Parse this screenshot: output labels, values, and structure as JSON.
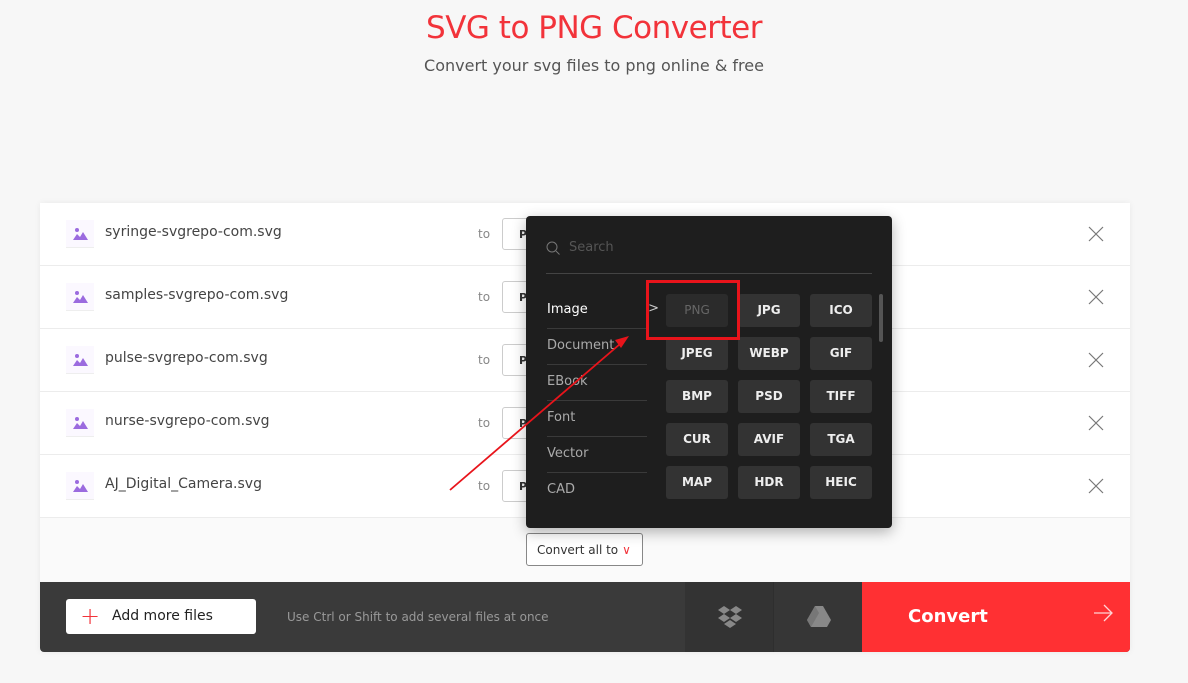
{
  "header": {
    "title": "SVG to PNG Converter",
    "subtitle": "Convert your svg files to png online & free"
  },
  "files": [
    {
      "name": "syringe-svgrepo-com.svg",
      "to": "to",
      "format": "PNG"
    },
    {
      "name": "samples-svgrepo-com.svg",
      "to": "to",
      "format": "PNG"
    },
    {
      "name": "pulse-svgrepo-com.svg",
      "to": "to",
      "format": "PNG"
    },
    {
      "name": "nurse-svgrepo-com.svg",
      "to": "to",
      "format": "PNG"
    },
    {
      "name": "AJ_Digital_Camera.svg",
      "to": "to",
      "format": "PNG"
    }
  ],
  "dropdown": {
    "search_placeholder": "Search",
    "categories": [
      "Image",
      "Document",
      "EBook",
      "Font",
      "Vector",
      "CAD"
    ],
    "formats": [
      "PNG",
      "JPG",
      "ICO",
      "JPEG",
      "WEBP",
      "GIF",
      "BMP",
      "PSD",
      "TIFF",
      "CUR",
      "AVIF",
      "TGA",
      "MAP",
      "HDR",
      "HEIC"
    ],
    "selected": "PNG"
  },
  "convert_all": "Convert all to",
  "footer": {
    "add_more": "Add more files",
    "hint": "Use Ctrl or Shift to add several files at once",
    "convert": "Convert"
  },
  "colors": {
    "accent": "#ff3033",
    "annotation": "#e8141b",
    "file_icon": "#9b6bdf"
  }
}
